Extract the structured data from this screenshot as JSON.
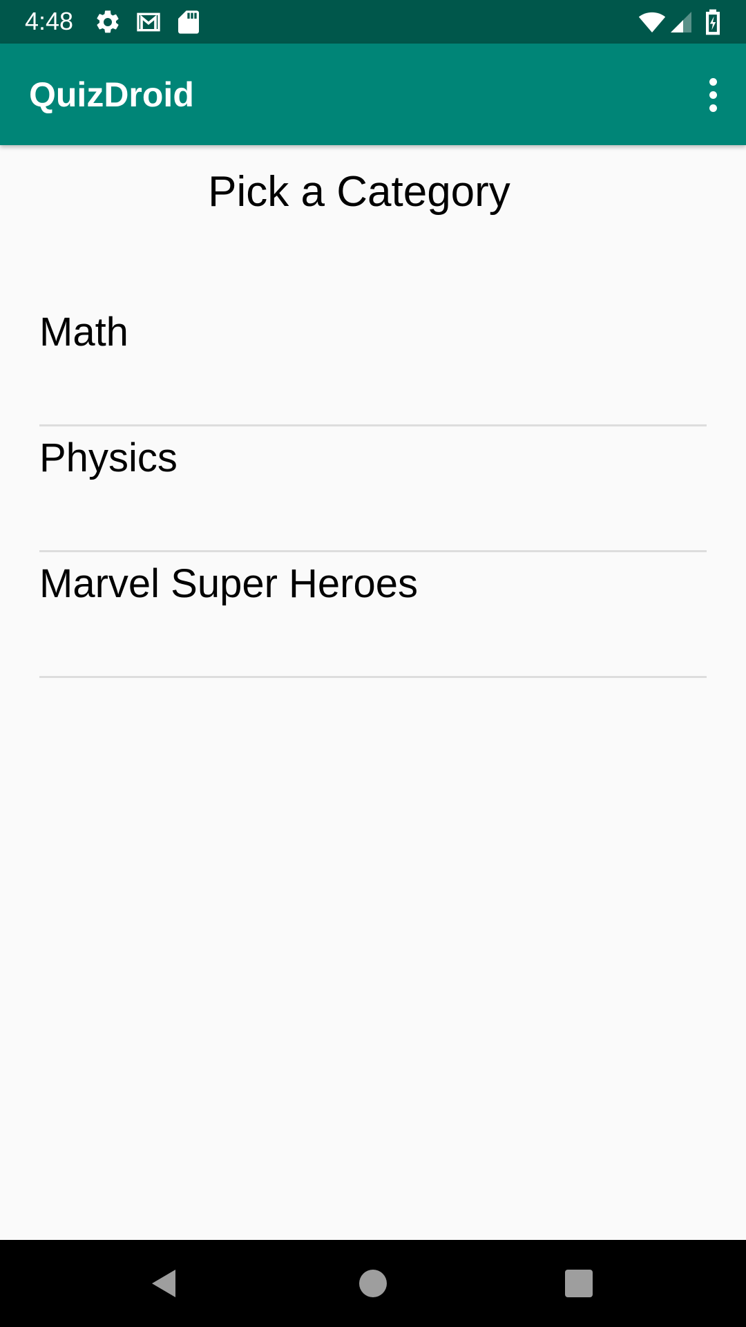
{
  "status_bar": {
    "time": "4:48",
    "background_color": "#00574b",
    "icons": [
      "settings-icon",
      "gmail-icon",
      "sd-card-icon",
      "wifi-icon",
      "cell-signal-icon",
      "battery-charging-icon"
    ]
  },
  "app_bar": {
    "title": "QuizDroid",
    "background_color": "#008577",
    "overflow_icon": "more-vert-icon"
  },
  "main": {
    "heading": "Pick a Category",
    "categories": [
      {
        "label": "Math"
      },
      {
        "label": "Physics"
      },
      {
        "label": "Marvel Super Heroes"
      }
    ]
  },
  "nav_bar": {
    "buttons": [
      "back-icon",
      "home-icon",
      "recents-icon"
    ]
  }
}
